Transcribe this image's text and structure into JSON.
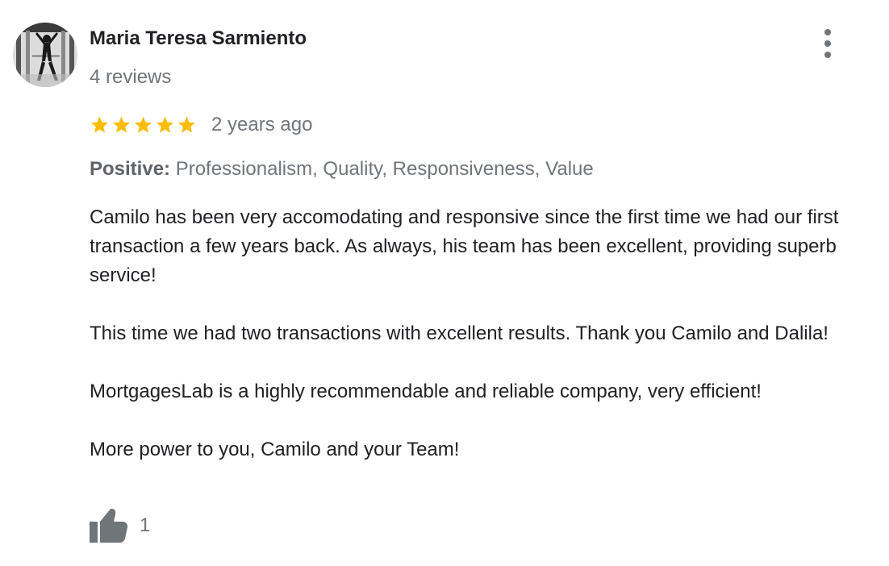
{
  "reviewer": {
    "name": "Maria Teresa Sarmiento",
    "review_count": "4 reviews",
    "avatar_icon": "reviewer-photo"
  },
  "menu": {
    "icon": "more-vert-icon"
  },
  "rating": {
    "stars": 5,
    "max_stars": 5,
    "star_color": "#fbbc04",
    "date": "2 years ago"
  },
  "attributes": {
    "label": "Positive:",
    "values": "Professionalism, Quality, Responsiveness, Value"
  },
  "body": {
    "paragraphs": [
      "Camilo has been very accomodating and responsive since the first time we had our first transaction a few years back. As always, his team has been excellent,  providing superb service!",
      "This time we had two transactions with excellent results. Thank you Camilo and Dalila!",
      "MortgagesLab is a highly recommendable and reliable company, very efficient!",
      "More power to you, Camilo and your Team!"
    ]
  },
  "likes": {
    "icon": "thumbs-up-icon",
    "count": "1"
  },
  "colors": {
    "primary_text": "#202124",
    "secondary_text": "#70757a",
    "star": "#fbbc04"
  }
}
